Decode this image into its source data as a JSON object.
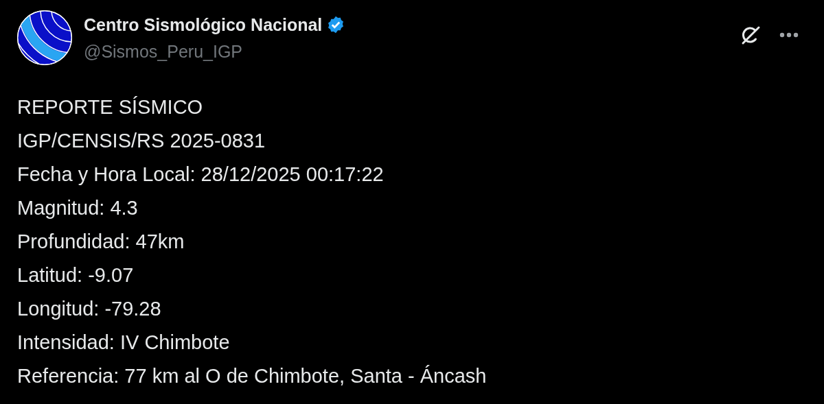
{
  "post": {
    "author": {
      "name": "Centro Sismológico Nacional",
      "verified": true,
      "handle": "@Sismos_Peru_IGP"
    },
    "lines": [
      "REPORTE SÍSMICO",
      "IGP/CENSIS/RS 2025-0831",
      "Fecha y Hora Local: 28/12/2025 00:17:22",
      "Magnitud: 4.3",
      "Profundidad: 47km",
      "Latitud: -9.07",
      "Longitud: -79.28",
      "Intensidad: IV Chimbote",
      "Referencia: 77 km al O de Chimbote, Santa - Áncash"
    ]
  }
}
